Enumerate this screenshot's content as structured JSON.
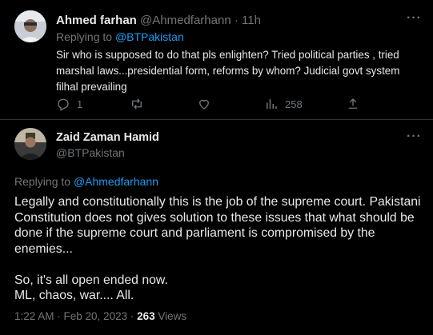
{
  "reply_tweet": {
    "author_name": "Ahmed farhan",
    "author_handle": "@Ahmedfarhann",
    "separator": "·",
    "time_ago": "11h",
    "replying_prefix": "Replying to ",
    "replying_to": "@BTPakistan",
    "text": "Sir who is supposed to do that pls enlighten? Tried political parties , tried marshal laws...presidential form, reforms  by whom?  Judicial govt system filhal prevailing",
    "actions": {
      "reply_count": "1",
      "retweet_count": "",
      "like_count": "",
      "views_count": "258"
    },
    "icons": [
      "reply-icon",
      "retweet-icon",
      "like-icon",
      "views-icon",
      "share-icon",
      "more-icon"
    ]
  },
  "main_tweet": {
    "author_name": "Zaid Zaman Hamid",
    "author_handle": "@BTPakistan",
    "replying_prefix": "Replying to ",
    "replying_to": "@Ahmedfarhann",
    "paragraph_1": "Legally and constitutionally this is the job of the supreme court. Pakistani Constitution does not gives solution to these issues that what should be done if the supreme court and parliament is compromised by the enemies...",
    "paragraph_2_line_1": "So, it's all open ended now.",
    "paragraph_2_line_2": "ML, chaos, war.... All.",
    "timestamp": "1:22 AM · Feb 20, 2023 · ",
    "views_count": "263",
    "views_label": " Views"
  },
  "more_glyph": "···",
  "colors": {
    "background": "#000000",
    "text": "#e7e9ea",
    "secondary": "#71767b",
    "accent": "#1d9bf0",
    "divider": "#2f3336"
  }
}
